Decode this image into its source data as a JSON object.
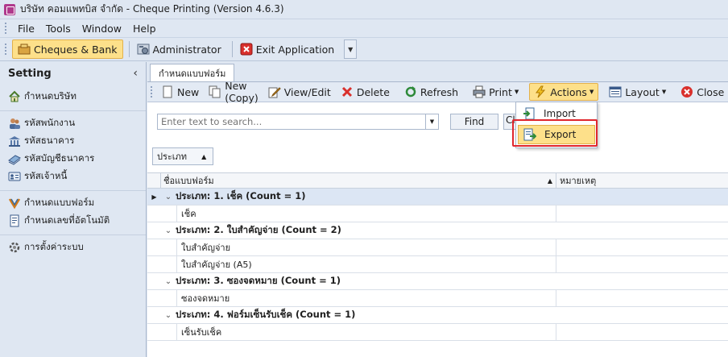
{
  "window": {
    "title": "บริษัท คอมแพทบิส จำกัด - Cheque Printing (Version 4.6.3)"
  },
  "menu": [
    "File",
    "Tools",
    "Window",
    "Help"
  ],
  "toolbar": {
    "cheques_bank": "Cheques & Bank",
    "administrator": "Administrator",
    "exit": "Exit Application"
  },
  "sidebar": {
    "title": "Setting",
    "collapse": "‹",
    "groups": [
      [
        "กำหนดบริษัท"
      ],
      [
        "รหัสพนักงาน",
        "รหัสธนาคาร",
        "รหัสบัญชีธนาคาร",
        "รหัสเจ้าหนี้"
      ],
      [
        "กำหนดแบบฟอร์ม",
        "กำหนดเลขที่อัตโนมัติ"
      ],
      [
        "การตั้งค่าระบบ"
      ]
    ]
  },
  "document": {
    "tab": "กำหนดแบบฟอร์ม",
    "toolbar": {
      "new": "New",
      "new_copy": "New (Copy)",
      "view_edit": "View/Edit",
      "delete": "Delete",
      "refresh": "Refresh",
      "print": "Print",
      "actions": "Actions",
      "layout": "Layout",
      "close": "Close"
    },
    "search": {
      "placeholder": "Enter text to search...",
      "find": "Find",
      "clear": "Clear"
    },
    "group_by": "ประเภท",
    "columns": {
      "name": "ชื่อแบบฟอร์ม",
      "note": "หมายเหตุ"
    },
    "groups": [
      {
        "label": "ประเภท: 1. เช็ค (Count = 1)",
        "rows": [
          "เช็ค"
        ]
      },
      {
        "label": "ประเภท: 2. ใบสำคัญจ่าย (Count = 2)",
        "rows": [
          "ใบสำคัญจ่าย",
          "ใบสำคัญจ่าย (A5)"
        ]
      },
      {
        "label": "ประเภท: 3. ซองจดหมาย (Count = 1)",
        "rows": [
          "ซองจดหมาย"
        ]
      },
      {
        "label": "ประเภท: 4. ฟอร์มเซ็นรับเช็ค (Count = 1)",
        "rows": [
          "เซ็นรับเช็ค"
        ]
      }
    ]
  },
  "actions_menu": {
    "import": "Import",
    "export": "Export"
  }
}
